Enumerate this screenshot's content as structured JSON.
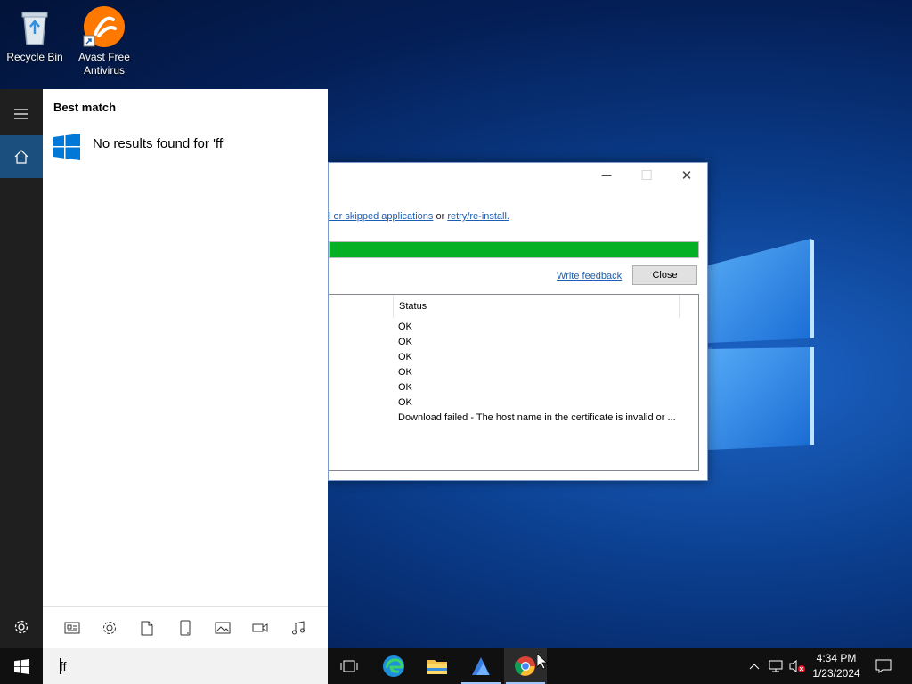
{
  "desktop": {
    "icons": [
      {
        "label": "Recycle Bin"
      },
      {
        "label": "Avast Free Antivirus"
      }
    ]
  },
  "installer": {
    "link_line": {
      "link1": "l or skipped applications",
      "middle": " or ",
      "link2": "retry/re-install."
    },
    "progress_fraction": 1.0,
    "write_feedback": "Write feedback",
    "close_label": "Close",
    "status_header": "Status",
    "statuses": [
      "OK",
      "OK",
      "OK",
      "OK",
      "OK",
      "OK",
      "Download failed - The host name in the certificate is invalid or ..."
    ]
  },
  "start_menu": {
    "best_match": "Best match",
    "result_text": "No results found for 'ff'",
    "filters": [
      "apps-icon",
      "settings-icon",
      "documents-icon",
      "mobile-icon",
      "photos-icon",
      "videos-icon",
      "music-icon"
    ]
  },
  "taskbar": {
    "search_value": "ff",
    "apps": [
      "task-view-icon",
      "edge-icon",
      "file-explorer-icon",
      "app-icon",
      "chrome-icon"
    ],
    "clock": {
      "time": "4:34 PM",
      "date": "1/23/2024"
    }
  },
  "colors": {
    "progress_green": "#06b025",
    "rail_active": "#1b4f7d",
    "link_blue": "#1a5fb4"
  }
}
